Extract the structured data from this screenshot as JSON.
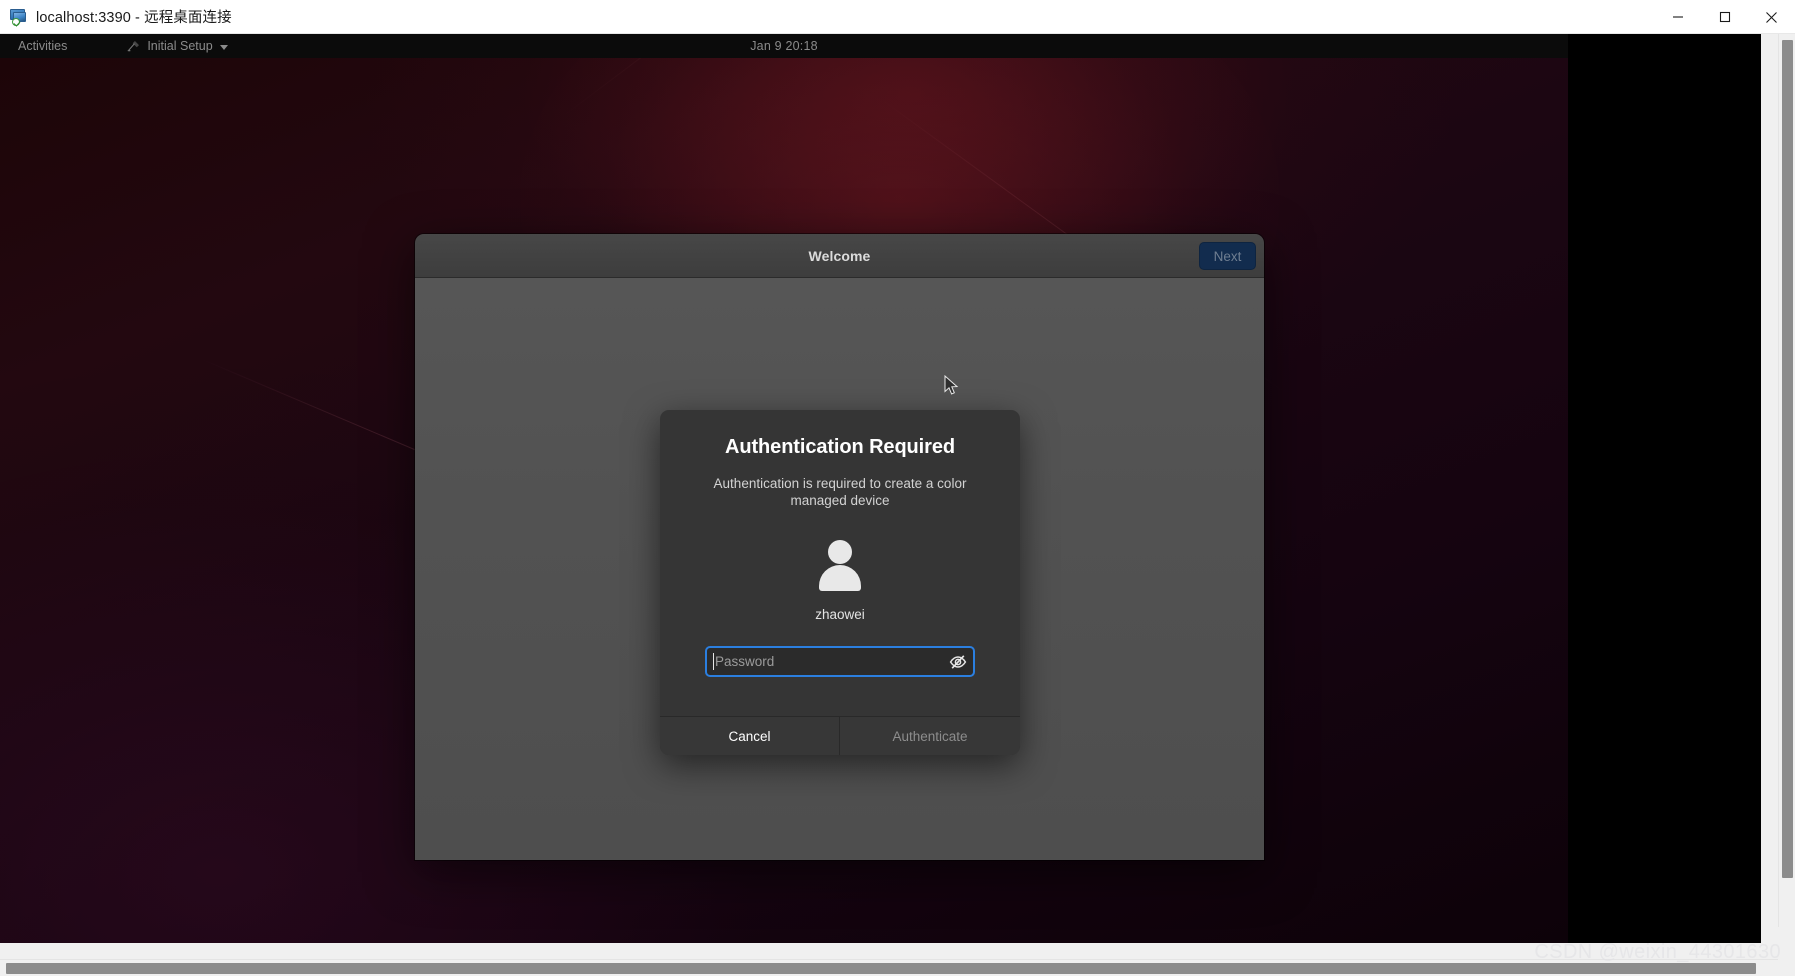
{
  "host_window": {
    "title": "localhost:3390 - 远程桌面连接",
    "app_icon": "remote-desktop-icon",
    "controls": {
      "minimize": "minimize-icon",
      "maximize": "maximize-icon",
      "close": "close-icon"
    }
  },
  "gnome_topbar": {
    "activities_label": "Activities",
    "app_menu_label": "Initial Setup",
    "app_menu_icon": "initial-setup-icon",
    "app_menu_arrow": "chevron-down-icon",
    "clock": "Jan 9  20:18"
  },
  "welcome_window": {
    "title": "Welcome",
    "next_label": "Next",
    "next_enabled": false
  },
  "auth_dialog": {
    "heading": "Authentication Required",
    "message": "Authentication is required to create a color managed device",
    "avatar_icon": "user-avatar-icon",
    "username": "zhaowei",
    "password": {
      "value": "",
      "placeholder": "Password",
      "visibility_icon": "eye-slash-icon"
    },
    "cancel_label": "Cancel",
    "authenticate_label": "Authenticate",
    "authenticate_enabled": false
  },
  "colors": {
    "focus_blue": "#2b7fe0",
    "suggested_button": "#122c4e",
    "dialog_bg": "#353535",
    "window_body": "#525252",
    "headerbar": "#424242"
  },
  "watermark": "CSDN @weixin_44301630"
}
